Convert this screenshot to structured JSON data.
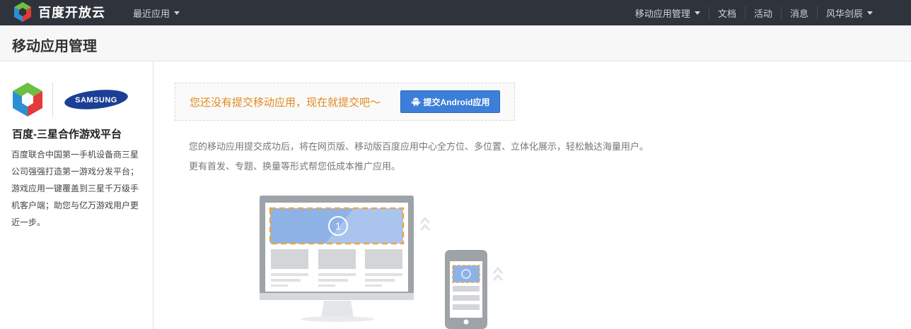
{
  "topbar": {
    "logo_text": "百度开放云",
    "recent_label": "最近应用",
    "nav": [
      {
        "label": "移动应用管理",
        "has_caret": true
      },
      {
        "label": "文档",
        "has_caret": false
      },
      {
        "label": "活动",
        "has_caret": false
      },
      {
        "label": "消息",
        "has_caret": false
      },
      {
        "label": "风华剑辰",
        "has_caret": true
      }
    ]
  },
  "page": {
    "title": "移动应用管理"
  },
  "sidebar": {
    "partner_logo_text": "SAMSUNG",
    "title": "百度-三星合作游戏平台",
    "description": "百度联合中国第一手机设备商三星公司强强打造第一游戏分发平台；游戏应用一键覆盖到三星千万级手机客户端；助您与亿万游戏用户更近一步。"
  },
  "main": {
    "notice_text": "您还没有提交移动应用，现在就提交吧～",
    "submit_button": "提交Android应用",
    "desc_line1": "您的移动应用提交成功后，将在网页版、移动版百度应用中心全方位、多位置、立体化展示，轻松触达海量用户。",
    "desc_line2": "更有首发、专题、换量等形式帮您低成本推广应用。",
    "illustration_badge": "1"
  },
  "colors": {
    "topbar_bg": "#2f333b",
    "accent_blue": "#3c7fd8",
    "notice_orange": "#e08a1e"
  }
}
